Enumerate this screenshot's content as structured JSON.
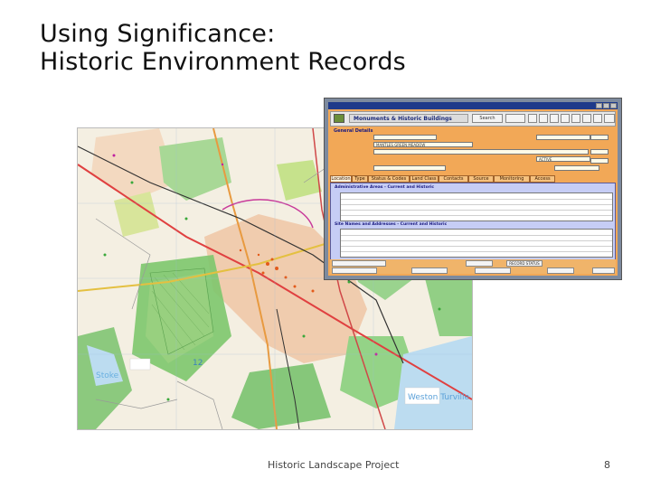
{
  "slide": {
    "title_line1": "Using Significance:",
    "title_line2": "Historic Environment Records",
    "footer": "Historic Landscape Project",
    "page_number": "8"
  },
  "map": {
    "labels": [
      "Stoke",
      "Weston Turville",
      "12"
    ]
  },
  "hdb_window": {
    "banner_title": "Monuments & Historic Buildings",
    "section_general": "General Details",
    "section_admin": "Administrative Areas - Current and Historic",
    "section_sites": "Site Names and Addresses - Current and Historic",
    "tabs": [
      "Location",
      "Type",
      "Status & Codes",
      "Land Class",
      "Contacts",
      "Source",
      "Monitoring",
      "Access"
    ],
    "fields": {
      "record_name_value": "MANTLES GREEN MEADOW",
      "status_value": "ACTIVE"
    },
    "buttons": {
      "search": "Search",
      "record_status": "RECORD STATUS"
    },
    "colors": {
      "window_bg": "#f2a857",
      "titlebar": "#1f3a8a",
      "panel": "#c6cdf5",
      "tab_active": "#fff3dd"
    }
  }
}
